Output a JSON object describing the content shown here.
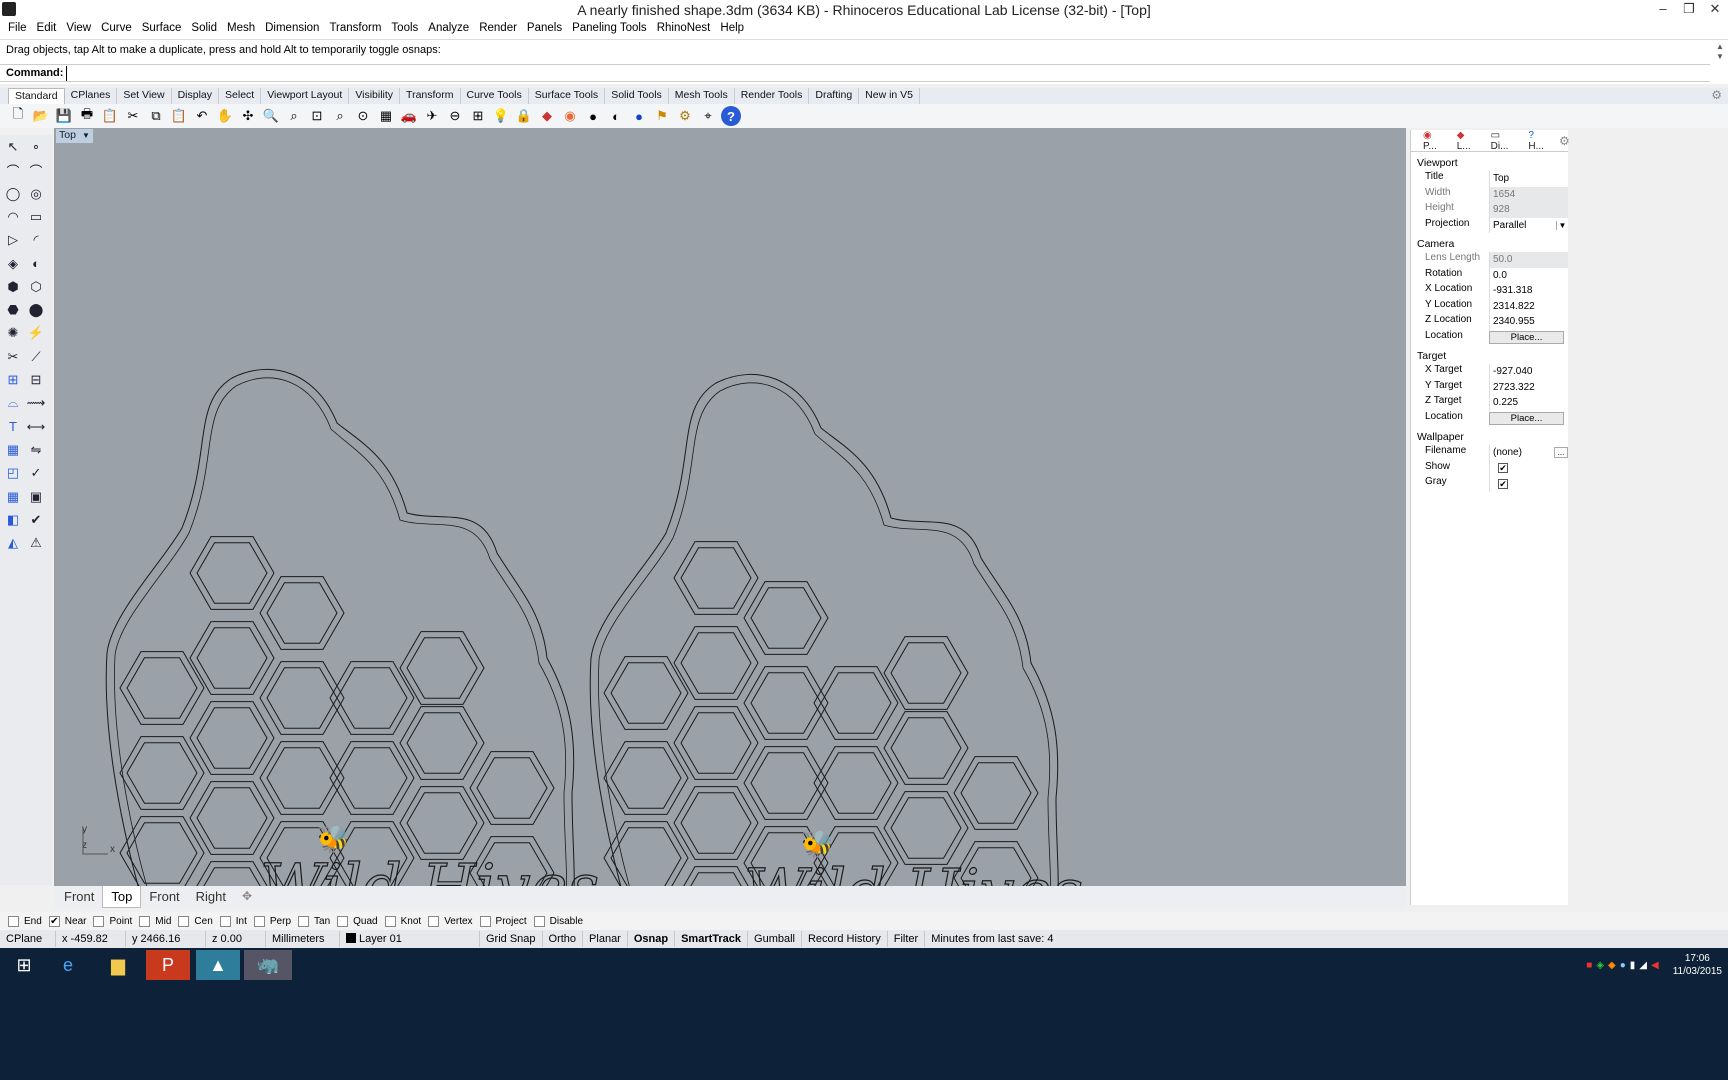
{
  "window": {
    "title": "A nearly finished shape.3dm (3634 KB) - Rhinoceros Educational Lab License (32-bit) - [Top]",
    "minimize": "–",
    "restore": "❐",
    "close": "✕"
  },
  "menu": [
    "File",
    "Edit",
    "View",
    "Curve",
    "Surface",
    "Solid",
    "Mesh",
    "Dimension",
    "Transform",
    "Tools",
    "Analyze",
    "Render",
    "Panels",
    "Paneling Tools",
    "RhinoNest",
    "Help"
  ],
  "command": {
    "prompt": "Drag objects, tap Alt to make a duplicate, press and hold Alt to temporarily toggle osnaps:",
    "label": "Command:",
    "value": ""
  },
  "toolbar_tabs": [
    "Standard",
    "CPlanes",
    "Set View",
    "Display",
    "Select",
    "Viewport Layout",
    "Visibility",
    "Transform",
    "Curve Tools",
    "Surface Tools",
    "Solid Tools",
    "Mesh Tools",
    "Render Tools",
    "Drafting",
    "New in V5"
  ],
  "toolbar_icons": [
    "new-file-icon",
    "open-folder-icon",
    "save-icon",
    "print-icon",
    "import-icon",
    "cut-icon",
    "copy-icon",
    "paste-icon",
    "undo-icon",
    "pan-hand-icon",
    "rotate-view-icon",
    "zoom-icon",
    "zoom-window-icon",
    "zoom-extents-icon",
    "zoom-selected-icon",
    "zoom-all-icon",
    "viewport-grid-icon",
    "car-icon",
    "helicopter-icon",
    "circle-icon",
    "cplane-icon",
    "light-bulb-icon",
    "lock-icon",
    "layer-icon",
    "color-wheel-icon",
    "sphere-icon",
    "render-preview-icon",
    "render-icon",
    "flag-icon",
    "settings-icon",
    "osnap-icon",
    "help-icon"
  ],
  "viewport": {
    "title": "Top",
    "text_left": "Wild Hives",
    "text_right": "Wild Hives",
    "axis_y": "y",
    "axis_z": "z",
    "axis_x": "x"
  },
  "viewport_tabs": [
    "Front",
    "Top",
    "Front",
    "Right"
  ],
  "properties": {
    "tabs": [
      "P...",
      "L...",
      "Di...",
      "H..."
    ],
    "viewport_section": "Viewport",
    "title_label": "Title",
    "title_value": "Top",
    "width_label": "Width",
    "width_value": "1654",
    "height_label": "Height",
    "height_value": "928",
    "projection_label": "Projection",
    "projection_value": "Parallel",
    "camera_section": "Camera",
    "lens_label": "Lens Length",
    "lens_value": "50.0",
    "rotation_label": "Rotation",
    "rotation_value": "0.0",
    "cam_x_label": "X Location",
    "cam_x_value": "-931.318",
    "cam_y_label": "Y Location",
    "cam_y_value": "2314.822",
    "cam_z_label": "Z Location",
    "cam_z_value": "2340.955",
    "cam_loc_label": "Location",
    "place_label": "Place...",
    "target_section": "Target",
    "tgt_x_label": "X Target",
    "tgt_x_value": "-927.040",
    "tgt_y_label": "Y Target",
    "tgt_y_value": "2723.322",
    "tgt_z_label": "Z Target",
    "tgt_z_value": "0.225",
    "tgt_loc_label": "Location",
    "wallpaper_section": "Wallpaper",
    "filename_label": "Filename",
    "filename_value": "(none)",
    "browse": "...",
    "show_label": "Show",
    "show_checked": true,
    "gray_label": "Gray",
    "gray_checked": true
  },
  "osnaps": [
    {
      "label": "End",
      "checked": false
    },
    {
      "label": "Near",
      "checked": true
    },
    {
      "label": "Point",
      "checked": false
    },
    {
      "label": "Mid",
      "checked": false
    },
    {
      "label": "Cen",
      "checked": false
    },
    {
      "label": "Int",
      "checked": false
    },
    {
      "label": "Perp",
      "checked": false
    },
    {
      "label": "Tan",
      "checked": false
    },
    {
      "label": "Quad",
      "checked": false
    },
    {
      "label": "Knot",
      "checked": false
    },
    {
      "label": "Vertex",
      "checked": false
    },
    {
      "label": "Project",
      "checked": false
    },
    {
      "label": "Disable",
      "checked": false
    }
  ],
  "status": {
    "cplane": "CPlane",
    "x": "x -459.82",
    "y": "y 2466.16",
    "z": "z 0.00",
    "units": "Millimeters",
    "layer": "Layer 01",
    "grid_snap": "Grid Snap",
    "ortho": "Ortho",
    "planar": "Planar",
    "osnap": "Osnap",
    "smarttrack": "SmartTrack",
    "gumball": "Gumball",
    "record_history": "Record History",
    "filter": "Filter",
    "last_save": "Minutes from last save: 4"
  },
  "taskbar": {
    "time": "17:06",
    "date": "11/03/2015"
  },
  "colors": {
    "viewport_bg": "#9aa1a9",
    "taskbar_bg": "#0d2238",
    "curve": "#1a1a1a"
  }
}
